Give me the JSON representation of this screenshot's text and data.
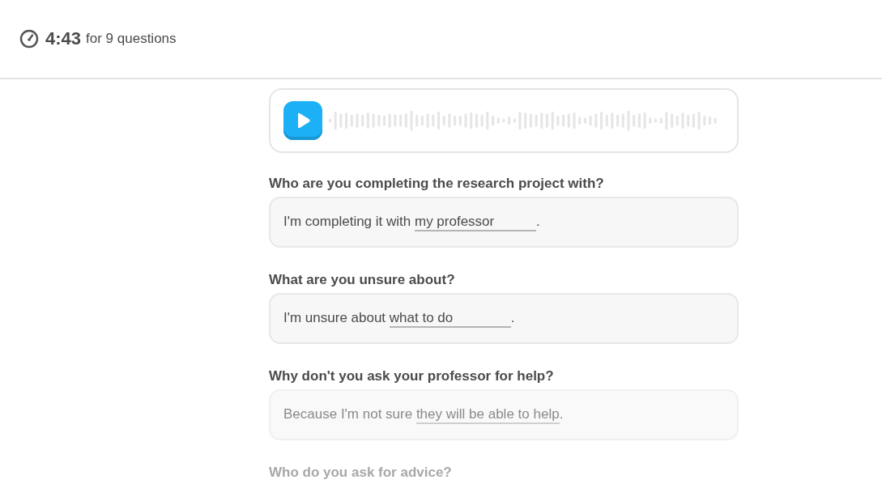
{
  "timer": {
    "time": "4:43",
    "caption": "for 9 questions"
  },
  "audio": {
    "playing": false
  },
  "questions": [
    {
      "kind": "active",
      "prompt": "Who are you completing the research project with?",
      "before": "I'm completing it with ",
      "answer": "my professor",
      "after": "."
    },
    {
      "kind": "active",
      "prompt": "What are you unsure about?",
      "before": "I'm unsure about ",
      "answer": "what to do",
      "after": "."
    },
    {
      "kind": "fading",
      "prompt": "Why don't you ask your professor for help?",
      "before": "Because I'm not sure ",
      "answer": "they will be able to help",
      "after": "."
    },
    {
      "kind": "upcoming",
      "prompt": "Who do you ask for advice?"
    }
  ]
}
